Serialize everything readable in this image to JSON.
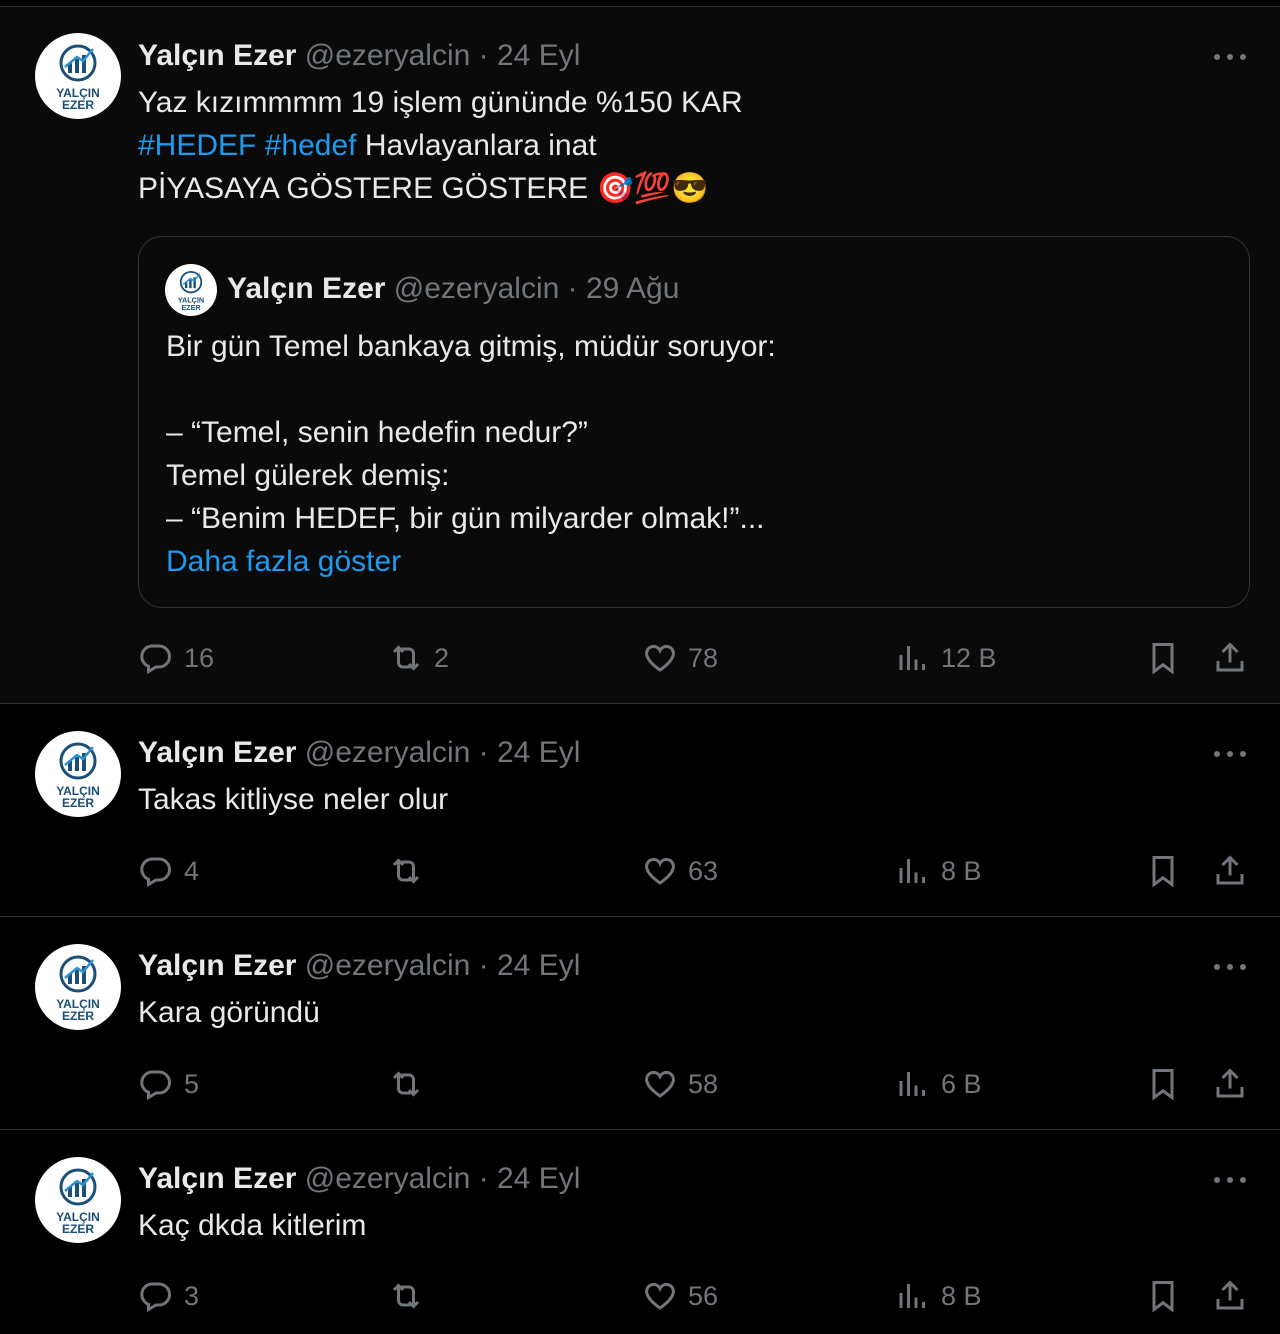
{
  "author": {
    "name": "Yalçın Ezer",
    "handle": "@ezeryalcin",
    "separator": "·",
    "avatar_text": [
      "YALÇIN",
      "EZER"
    ]
  },
  "tweets": [
    {
      "date": "24 Eyl",
      "lines": {
        "l1": "Yaz kızımmmm 19 işlem gününde %150 KAR",
        "tag1": "#HEDEF",
        "tag2": "#hedef",
        "l2rest": "Havlayanlara inat",
        "l3": "PİYASAYA GÖSTERE GÖSTERE",
        "emoji": "🎯💯😎"
      },
      "quote": {
        "date": "29 Ağu",
        "lines": [
          "Bir gün Temel bankaya gitmiş, müdür soruyor:",
          "– “Temel, senin hedefin nedur?”",
          "Temel gülerek demiş:",
          "– “Benim HEDEF, bir gün milyarder olmak!”..."
        ],
        "show_more": "Daha fazla göster"
      },
      "stats": {
        "replies": "16",
        "retweets": "2",
        "likes": "78",
        "views": "12 B"
      }
    },
    {
      "date": "24 Eyl",
      "text": "Takas kitliyse neler olur",
      "stats": {
        "replies": "4",
        "retweets": "",
        "likes": "63",
        "views": "8 B"
      }
    },
    {
      "date": "24 Eyl",
      "text": "Kara göründü",
      "stats": {
        "replies": "5",
        "retweets": "",
        "likes": "58",
        "views": "6 B"
      }
    },
    {
      "date": "24 Eyl",
      "text": "Kaç dkda kitlerim",
      "stats": {
        "replies": "3",
        "retweets": "",
        "likes": "56",
        "views": "8 B"
      }
    }
  ],
  "colors": {
    "background": "#000000",
    "text": "#e7e9ea",
    "muted": "#71767b",
    "link": "#1d9bf0",
    "border": "#2f3336"
  },
  "icons": [
    "reply-icon",
    "retweet-icon",
    "like-icon",
    "views-icon",
    "bookmark-icon",
    "share-icon",
    "more-icon"
  ]
}
